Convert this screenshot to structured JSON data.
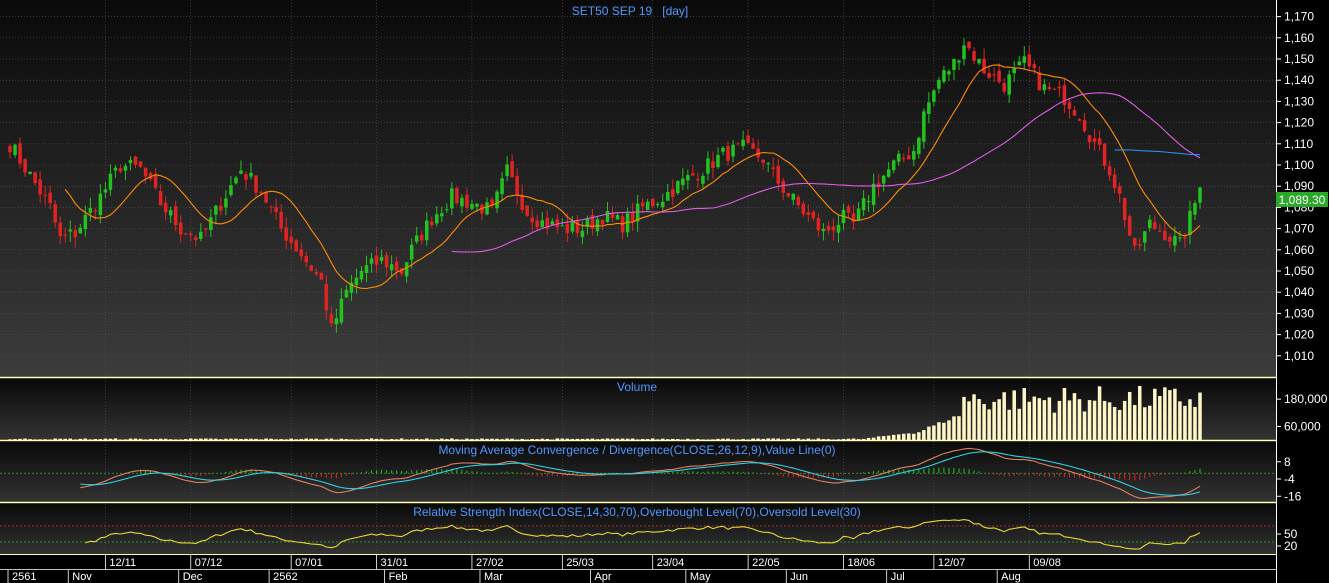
{
  "colors": {
    "background": "#000000",
    "panel_top": "#111111",
    "panel_bottom": "#3a3a3a",
    "grid": "#555555",
    "up_candle": "#22c31f",
    "down_candle": "#e02323",
    "ma_fast": "#ff8c00",
    "ma_slow": "#e05be8",
    "ma_blue": "#2a8df0",
    "title_text": "#4f98ff",
    "axis_text": "#ffffff",
    "separator": "#ffffb0",
    "volume_bar": "#fff6c8",
    "macd_line": "#e08060",
    "macd_signal": "#30d0e0",
    "rsi_line": "#e8d830",
    "overbought": "#cc3030",
    "oversold": "#30b030",
    "price_label_bg": "#2aa82a"
  },
  "chart_data": [
    {
      "type": "candlestick",
      "title": "SET50 SEP 19   [day]",
      "last_price": "1,089.30",
      "ylim": [
        1000,
        1175
      ],
      "y_ticks": [
        "1,010",
        "1,020",
        "1,030",
        "1,040",
        "1,050",
        "1,060",
        "1,070",
        "1,080",
        "1,090",
        "1,100",
        "1,110",
        "1,120",
        "1,130",
        "1,140",
        "1,150",
        "1,160",
        "1,170"
      ],
      "y_tick_values": [
        1010,
        1020,
        1030,
        1040,
        1050,
        1060,
        1070,
        1080,
        1090,
        1100,
        1110,
        1120,
        1130,
        1140,
        1150,
        1160,
        1170
      ],
      "sessions": 200,
      "anchors": [
        [
          0,
          1110
        ],
        [
          4,
          1095
        ],
        [
          8,
          1080
        ],
        [
          10,
          1065
        ],
        [
          13,
          1068
        ],
        [
          18,
          1085
        ],
        [
          22,
          1100
        ],
        [
          26,
          1098
        ],
        [
          30,
          1082
        ],
        [
          34,
          1070
        ],
        [
          38,
          1065
        ],
        [
          42,
          1082
        ],
        [
          46,
          1098
        ],
        [
          50,
          1088
        ],
        [
          54,
          1070
        ],
        [
          58,
          1058
        ],
        [
          62,
          1045
        ],
        [
          64,
          1022
        ],
        [
          67,
          1040
        ],
        [
          70,
          1050
        ],
        [
          74,
          1055
        ],
        [
          78,
          1050
        ],
        [
          80,
          1060
        ],
        [
          84,
          1075
        ],
        [
          88,
          1085
        ],
        [
          92,
          1082
        ],
        [
          96,
          1078
        ],
        [
          99,
          1097
        ],
        [
          103,
          1078
        ],
        [
          106,
          1073
        ],
        [
          110,
          1070
        ],
        [
          114,
          1070
        ],
        [
          118,
          1076
        ],
        [
          122,
          1072
        ],
        [
          126,
          1080
        ],
        [
          130,
          1085
        ],
        [
          134,
          1092
        ],
        [
          138,
          1098
        ],
        [
          142,
          1105
        ],
        [
          146,
          1108
        ],
        [
          150,
          1103
        ],
        [
          152,
          1095
        ],
        [
          155,
          1086
        ],
        [
          158,
          1078
        ],
        [
          162,
          1068
        ],
        [
          166,
          1075
        ],
        [
          168,
          1072
        ],
        [
          172,
          1090
        ],
        [
          176,
          1100
        ],
        [
          180,
          1107
        ],
        [
          182,
          1124
        ],
        [
          185,
          1140
        ],
        [
          188,
          1148
        ],
        [
          190,
          1158
        ],
        [
          194,
          1145
        ],
        [
          198,
          1138
        ],
        [
          202,
          1148
        ],
        [
          206,
          1136
        ],
        [
          210,
          1132
        ],
        [
          213,
          1124
        ],
        [
          216,
          1110
        ],
        [
          219,
          1098
        ],
        [
          221,
          1085
        ],
        [
          224,
          1058
        ],
        [
          227,
          1072
        ],
        [
          230,
          1068
        ],
        [
          233,
          1062
        ],
        [
          235,
          1075
        ],
        [
          237,
          1089
        ]
      ]
    },
    {
      "type": "bar",
      "title": "Volume",
      "y_ticks": [
        "180,000",
        "60,000"
      ],
      "y_tick_values": [
        180000,
        60000
      ],
      "ylim": [
        0,
        260000
      ]
    },
    {
      "type": "line",
      "title": "Moving Average Convergence / Divergence(CLOSE,26,12,9),Value Line(0)",
      "y_ticks": [
        "8",
        "-4",
        "-16"
      ],
      "y_tick_values": [
        8,
        -4,
        -16
      ],
      "ylim": [
        -20,
        12
      ]
    },
    {
      "type": "line",
      "title": "Relative Strength Index(CLOSE,14,30,70),Overbought Level(70),Oversold Level(30)",
      "y_ticks": [
        "50",
        "20"
      ],
      "y_tick_values": [
        50,
        20
      ],
      "ylim": [
        0,
        90
      ],
      "overbought": 70,
      "oversold": 30
    }
  ],
  "x_axis": {
    "top_row": [
      {
        "label": "12/11",
        "idx": 19
      },
      {
        "label": "07/12",
        "idx": 36
      },
      {
        "label": "07/01",
        "idx": 56
      },
      {
        "label": "31/01",
        "idx": 73
      },
      {
        "label": "27/02",
        "idx": 92
      },
      {
        "label": "25/03",
        "idx": 110
      },
      {
        "label": "23/04",
        "idx": 128
      },
      {
        "label": "22/05",
        "idx": 147
      },
      {
        "label": "18/06",
        "idx": 166
      },
      {
        "label": "12/07",
        "idx": 184
      },
      {
        "label": "09/08",
        "idx": 203
      }
    ],
    "bottom_row": [
      {
        "label": "2561",
        "idx": 0
      },
      {
        "label": "Nov",
        "idx": 12
      },
      {
        "label": "Dec",
        "idx": 34
      },
      {
        "label": "2562",
        "idx": 52
      },
      {
        "label": "Feb",
        "idx": 75
      },
      {
        "label": "Mar",
        "idx": 94
      },
      {
        "label": "Apr",
        "idx": 116
      },
      {
        "label": "May",
        "idx": 135
      },
      {
        "label": "Jun",
        "idx": 155
      },
      {
        "label": "Jul",
        "idx": 175
      },
      {
        "label": "Aug",
        "idx": 197
      }
    ]
  }
}
